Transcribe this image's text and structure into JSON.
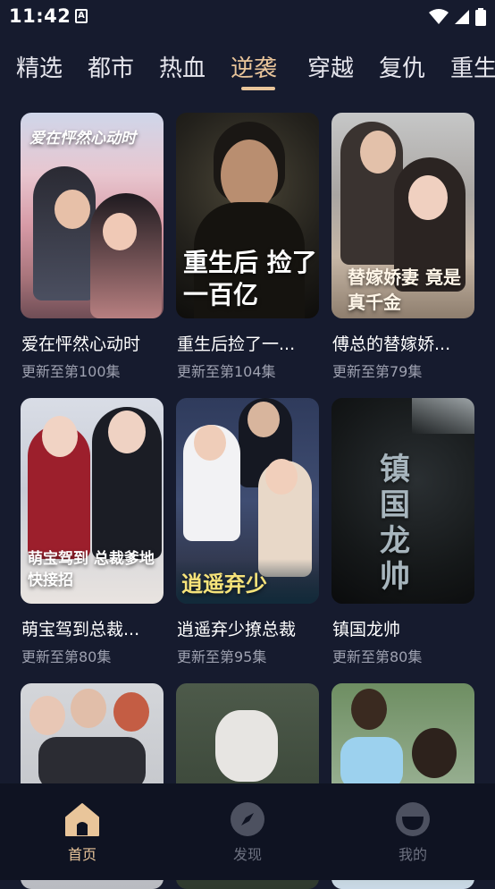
{
  "status_bar": {
    "time": "11:42"
  },
  "tabs": [
    "精选",
    "都市",
    "热血",
    "逆袭",
    "穿越",
    "复仇",
    "重生"
  ],
  "active_tab": "逆袭",
  "dramas": [
    {
      "title": "爱在怦然心动时",
      "subtitle": "更新至第100集",
      "poster_text": "爱在怦然心动时"
    },
    {
      "title": "重生后捡了一...",
      "subtitle": "更新至第104集",
      "poster_text": "重生后 捡了一百亿"
    },
    {
      "title": "傅总的替嫁娇...",
      "subtitle": "更新至第79集",
      "poster_text": "替嫁娇妻 竟是真千金"
    },
    {
      "title": "萌宝驾到总裁...",
      "subtitle": "更新至第80集",
      "poster_text": "萌宝驾到 总裁爹地快接招"
    },
    {
      "title": "逍遥弃少撩总裁",
      "subtitle": "更新至第95集",
      "poster_text": "逍遥弃少"
    },
    {
      "title": "镇国龙帅",
      "subtitle": "更新至第80集",
      "poster_text": "镇国龙帅"
    },
    {
      "title": "",
      "subtitle": "",
      "poster_text": ""
    },
    {
      "title": "",
      "subtitle": "",
      "poster_text": ""
    },
    {
      "title": "",
      "subtitle": "",
      "poster_text": ""
    }
  ],
  "bottom_nav": [
    {
      "label": "首页",
      "icon": "home-icon",
      "active": true
    },
    {
      "label": "发现",
      "icon": "compass-icon",
      "active": false
    },
    {
      "label": "我的",
      "icon": "profile-icon",
      "active": false
    }
  ],
  "colors": {
    "background": "#161b2e",
    "accent": "#e9c59a",
    "nav_bg": "#0f1322",
    "muted": "#9ea1b0"
  }
}
